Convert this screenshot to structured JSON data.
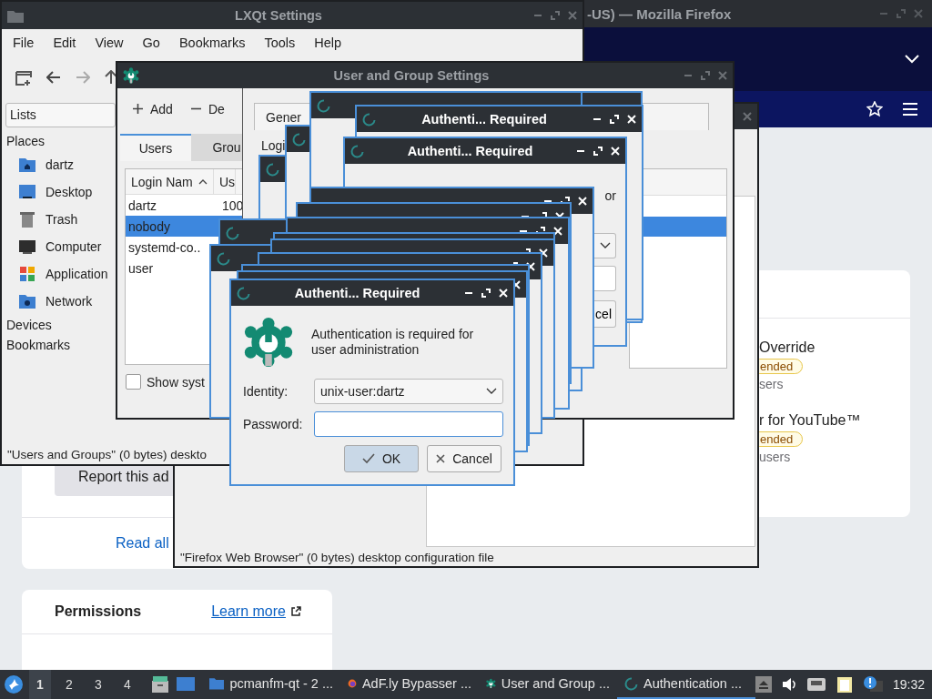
{
  "browser": {
    "title": "-US) — Mozilla Firefox",
    "report_button": "Report this ad",
    "read_all_link": "Read all",
    "permissions_heading": "Permissions",
    "learn_more_link": "Learn more",
    "addons": [
      {
        "name": "Override",
        "badge": "ended",
        "users": "sers"
      },
      {
        "name": "r for YouTube™",
        "badge": "ended",
        "users": "users"
      }
    ]
  },
  "back_file_manager": {
    "status": "\"Firefox Web Browser\" (0 bytes) desktop configuration file"
  },
  "file_manager": {
    "title": "LXQt Settings",
    "menu": [
      "File",
      "Edit",
      "View",
      "Go",
      "Bookmarks",
      "Tools",
      "Help"
    ],
    "view_mode": "Lists",
    "sidebar": [
      {
        "label": "Places",
        "items": [
          {
            "label": "dartz"
          },
          {
            "label": "Desktop"
          },
          {
            "label": "Trash"
          },
          {
            "label": "Computer"
          },
          {
            "label": "Application"
          },
          {
            "label": "Network"
          }
        ]
      },
      {
        "label": "Devices"
      },
      {
        "label": "Bookmarks"
      }
    ],
    "status": "\"Users and Groups\" (0 bytes) deskto"
  },
  "user_settings": {
    "title": "User and Group Settings",
    "toolbar": [
      "Add",
      "De"
    ],
    "tabs": [
      {
        "label": "Users",
        "selected": true
      },
      {
        "label": "Grou",
        "selected": false
      }
    ],
    "columns": [
      "Login Nam",
      "Us"
    ],
    "rows": [
      {
        "login": "dartz",
        "uid": "100",
        "selected": false
      },
      {
        "login": "nobody",
        "selected": true
      },
      {
        "login": "systemd-co..",
        "selected": false
      },
      {
        "login": "user",
        "selected": false
      }
    ],
    "show_system": {
      "label": "Show syst",
      "checked": false
    },
    "detail_tab": "Gener",
    "detail_label": "Logi"
  },
  "auth_back": [
    {
      "title": "Authenti... Required"
    },
    {
      "title": "Authenti... Required",
      "message": "or",
      "button": "cel"
    }
  ],
  "auth_dialog": {
    "title": "Authenti... Required",
    "message": "Authentication is required for user administration",
    "identity_label": "Identity:",
    "identity": "unix-user:dartz",
    "password_label": "Password:",
    "ok": "OK",
    "cancel": "Cancel"
  },
  "taskbar": {
    "workspaces": [
      {
        "label": "1",
        "selected": true
      },
      {
        "label": "2",
        "selected": false
      },
      {
        "label": "3",
        "selected": false
      },
      {
        "label": "4",
        "selected": false
      }
    ],
    "tasks": [
      {
        "label": "pcmanfm-qt - 2 ...",
        "selected": false
      },
      {
        "label": "AdF.ly Bypasser ...",
        "selected": false
      },
      {
        "label": "User and Group ...",
        "selected": false
      },
      {
        "label": "Authentication ...",
        "selected": true
      }
    ],
    "clock": "19:32"
  }
}
